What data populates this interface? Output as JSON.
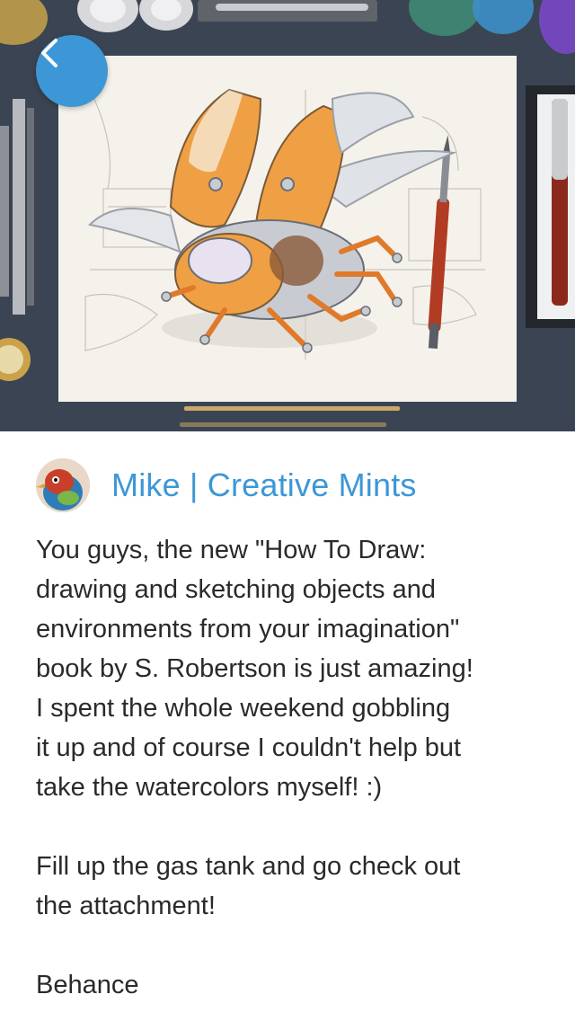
{
  "hero": {
    "image_alt": "Watercolor sketch of a robotic beetle on paper surrounded by pens and pencils",
    "back_icon": "chevron-left-icon"
  },
  "colors": {
    "accent": "#3d97d6",
    "text": "#2a2a2a",
    "desk": "#3b4452",
    "paper": "#f5f2ec",
    "beetle_orange": "#f0a044"
  },
  "author": {
    "name": "Mike | Creative Mints"
  },
  "post": {
    "lines": [
      "You guys, the new \"How To Draw:",
      "drawing and sketching objects and",
      "environments from your imagination\"",
      "book by S. Robertson is just amazing!",
      "I spent the whole weekend gobbling",
      "it up and of course I couldn't help but",
      "take the watercolors myself! :)"
    ],
    "lines2": [
      "Fill up the gas tank and go check out",
      "the attachment!"
    ],
    "footer": "Behance"
  }
}
